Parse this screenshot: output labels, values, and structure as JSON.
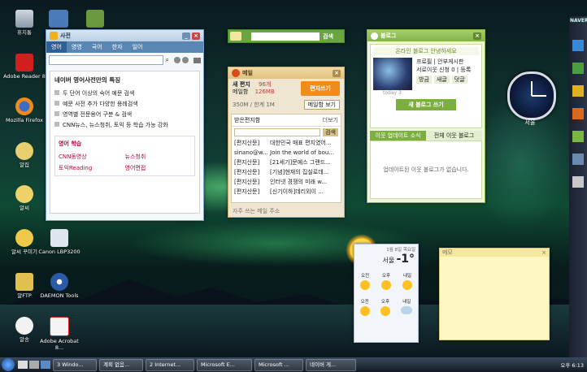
{
  "desktop_icons": [
    {
      "label": "휴지통",
      "name": "recycle-bin-icon"
    },
    {
      "label": "Adobe Reader 8",
      "name": "adobe-reader-icon"
    },
    {
      "label": "Mozilla Firefox",
      "name": "firefox-icon"
    },
    {
      "label": "알집",
      "name": "alzip-icon"
    },
    {
      "label": "알씨",
      "name": "alsee-icon"
    },
    {
      "label": "알씨 꾸미기",
      "name": "alsee-decorate-icon"
    },
    {
      "label": "알FTP",
      "name": "alftp-icon"
    },
    {
      "label": "알송",
      "name": "alsong-icon"
    },
    {
      "label": "Canon LBP3200",
      "name": "canon-printer-icon"
    },
    {
      "label": "DAEMON Tools",
      "name": "daemon-tools-icon"
    },
    {
      "label": "Adobe Acrobat 8...",
      "name": "acrobat-icon"
    }
  ],
  "dictionary": {
    "title": "사전",
    "tabs": [
      "영어",
      "영영",
      "국어",
      "한자",
      "일어"
    ],
    "section_title": "네이버 영어사전만의 특징",
    "features": [
      "두 단어 이상의 숙어 예문 검색",
      "예문 사전 추가 다양한 용례검색",
      "영역별 전문용어 구분 & 검색",
      "CNN뉴스, 뉴스청취, 토익 등 학습 가능 강화"
    ],
    "learn_title": "영어 학습",
    "learn_links": [
      "CNN동영상",
      "뉴스청취",
      "토익Reading",
      "영어면접"
    ]
  },
  "search_widget": {
    "button": "검색"
  },
  "mail": {
    "title": "메일",
    "new_mail_label": "새 편지",
    "new_mail_count": "96개",
    "mailbox_label": "메일함",
    "mailbox_size": "126MB",
    "compose_button": "편지쓰기",
    "quota_text": "350M / 한계 1M",
    "view_button": "메일함 보기",
    "inbox_label": "받은편지함",
    "more_label": "더보기",
    "search_button": "검색",
    "rows": [
      {
        "from": "[편지산문]",
        "subject": "대한민국 매표 편지였어..."
      },
      {
        "from": "sinano@w...",
        "subject": "Join the world of bou..."
      },
      {
        "from": "[편지산문]",
        "subject": "[21세기]문예스 그랜드..."
      },
      {
        "from": "[편지산문]",
        "subject": "[기념]현재의 집실로데..."
      },
      {
        "from": "[편지산문]",
        "subject": "인터넷 경쟁의 미래 w..."
      },
      {
        "from": "[편지산문]",
        "subject": "[신기이하]데리외이 ..."
      }
    ],
    "footer": "자주 쓰는 메일 주소"
  },
  "blog": {
    "title": "블로그",
    "banner": "온라인 블로그 안녕하세요",
    "profile_label": "프로필",
    "profile_value": "안부게시판",
    "neighbors_label": "서로이웃",
    "neighbors_value": "신청",
    "count_value": "0 | 등록",
    "today_label": "today 3",
    "tags": [
      "방금",
      "새글",
      "덧글"
    ],
    "write_button": "새 블로그 쓰기",
    "tab_active": "이웃 업데이트 소식",
    "tab_other": "전체 이웃 블로그",
    "empty_text": "업데이트된 이웃 블로그가 없습니다."
  },
  "clock": {
    "label": "서울"
  },
  "weather": {
    "date": "1월 8일 목요일",
    "city": "서울",
    "temp": "-1°",
    "days": [
      "오전",
      "오후",
      "내일"
    ],
    "row2": [
      "오전",
      "오후",
      "내일"
    ]
  },
  "memo": {
    "title": "메모"
  },
  "taskbar": {
    "items": [
      "3 Windo...",
      "계획 없음...",
      "2 Internet...",
      "Microsoft E...",
      "Microsoft ...",
      "네이버 게..."
    ],
    "time": "오후 6:13"
  },
  "sidebar_title": "NAVER"
}
